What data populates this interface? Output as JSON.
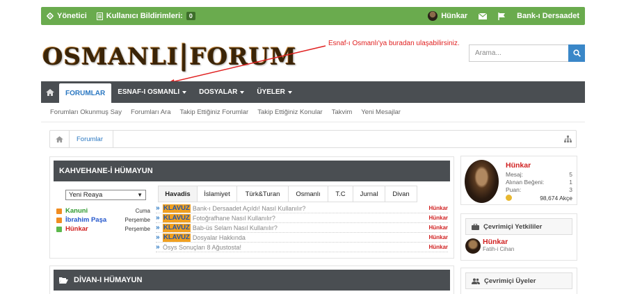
{
  "topbar": {
    "admin_label": "Yönetici",
    "notifications_label": "Kullanıcı Bildirimleri:",
    "notifications_count": "0",
    "username": "Hünkar",
    "bank_label": "Bank-ı Dersaadet",
    "bg_color": "#6aab4e"
  },
  "logo_text": "OSMANLIFORUM",
  "annotation": "Esnaf-ı Osmanlı'ya buradan ulaşabilirsiniz.",
  "search": {
    "placeholder": "Arama..."
  },
  "nav": {
    "tabs": [
      {
        "label": "FORUMLAR"
      },
      {
        "label": "ESNAF-I OSMANLI"
      },
      {
        "label": "DOSYALAR"
      },
      {
        "label": "ÜYELER"
      }
    ]
  },
  "subnav": [
    "Forumları Okunmuş Say",
    "Forumları Ara",
    "Takip Ettiğiniz Forumlar",
    "Takip Ettiğiniz Konular",
    "Takvim",
    "Yeni Mesajlar"
  ],
  "breadcrumb": {
    "item": "Forumlar"
  },
  "section1": {
    "title": "KAHVEHANE-İ HÜMAYUN",
    "select_value": "Yeni Reaya",
    "members": [
      {
        "name": "Kanuni",
        "day": "Cuma",
        "color": "#2e9a2e",
        "icon_color": "#f08c20"
      },
      {
        "name": "İbrahim Paşa",
        "day": "Perşembe",
        "color": "#2255cc",
        "icon_color": "#f08c20"
      },
      {
        "name": "Hünkar",
        "day": "Perşembe",
        "color": "#d02020",
        "icon_color": "#5cb84c"
      }
    ],
    "tabs": [
      "Havadis",
      "İslamiyet",
      "Türk&Turan",
      "Osmanlı",
      "T.C",
      "Jurnal",
      "Divan"
    ],
    "topics": [
      {
        "prefix": "KLAVUZ",
        "title": "Bank-ı Dersaadet Açıldı! Nasıl Kullanılır?",
        "user": "Hünkar"
      },
      {
        "prefix": "KLAVUZ",
        "title": "Fotoğrafhane Nasıl Kullanılır?",
        "user": "Hünkar"
      },
      {
        "prefix": "KLAVUZ",
        "title": "Bab-üs Selam Nasıl Kullanılır?",
        "user": "Hünkar"
      },
      {
        "prefix": "KLAVUZ",
        "title": "Dosyalar Hakkında",
        "user": "Hünkar"
      },
      {
        "prefix": "",
        "title": "Ösys Sonuçları 8 Ağustosta!",
        "user": "Hünkar"
      }
    ]
  },
  "section2": {
    "title": "DİVAN-I HÜMAYUN"
  },
  "profile": {
    "name": "Hünkar",
    "stats": [
      {
        "label": "Mesaj:",
        "value": "5"
      },
      {
        "label": "Alınan Beğeni:",
        "value": "1"
      },
      {
        "label": "Puan:",
        "value": "3"
      }
    ],
    "balance": "98,674 Akçe"
  },
  "online_staff": {
    "title": "Çevrimiçi Yetkililer",
    "name": "Hünkar",
    "rank": "Fatih-i Cihan"
  },
  "online_users": {
    "title": "Çevrimiçi Üyeler"
  }
}
